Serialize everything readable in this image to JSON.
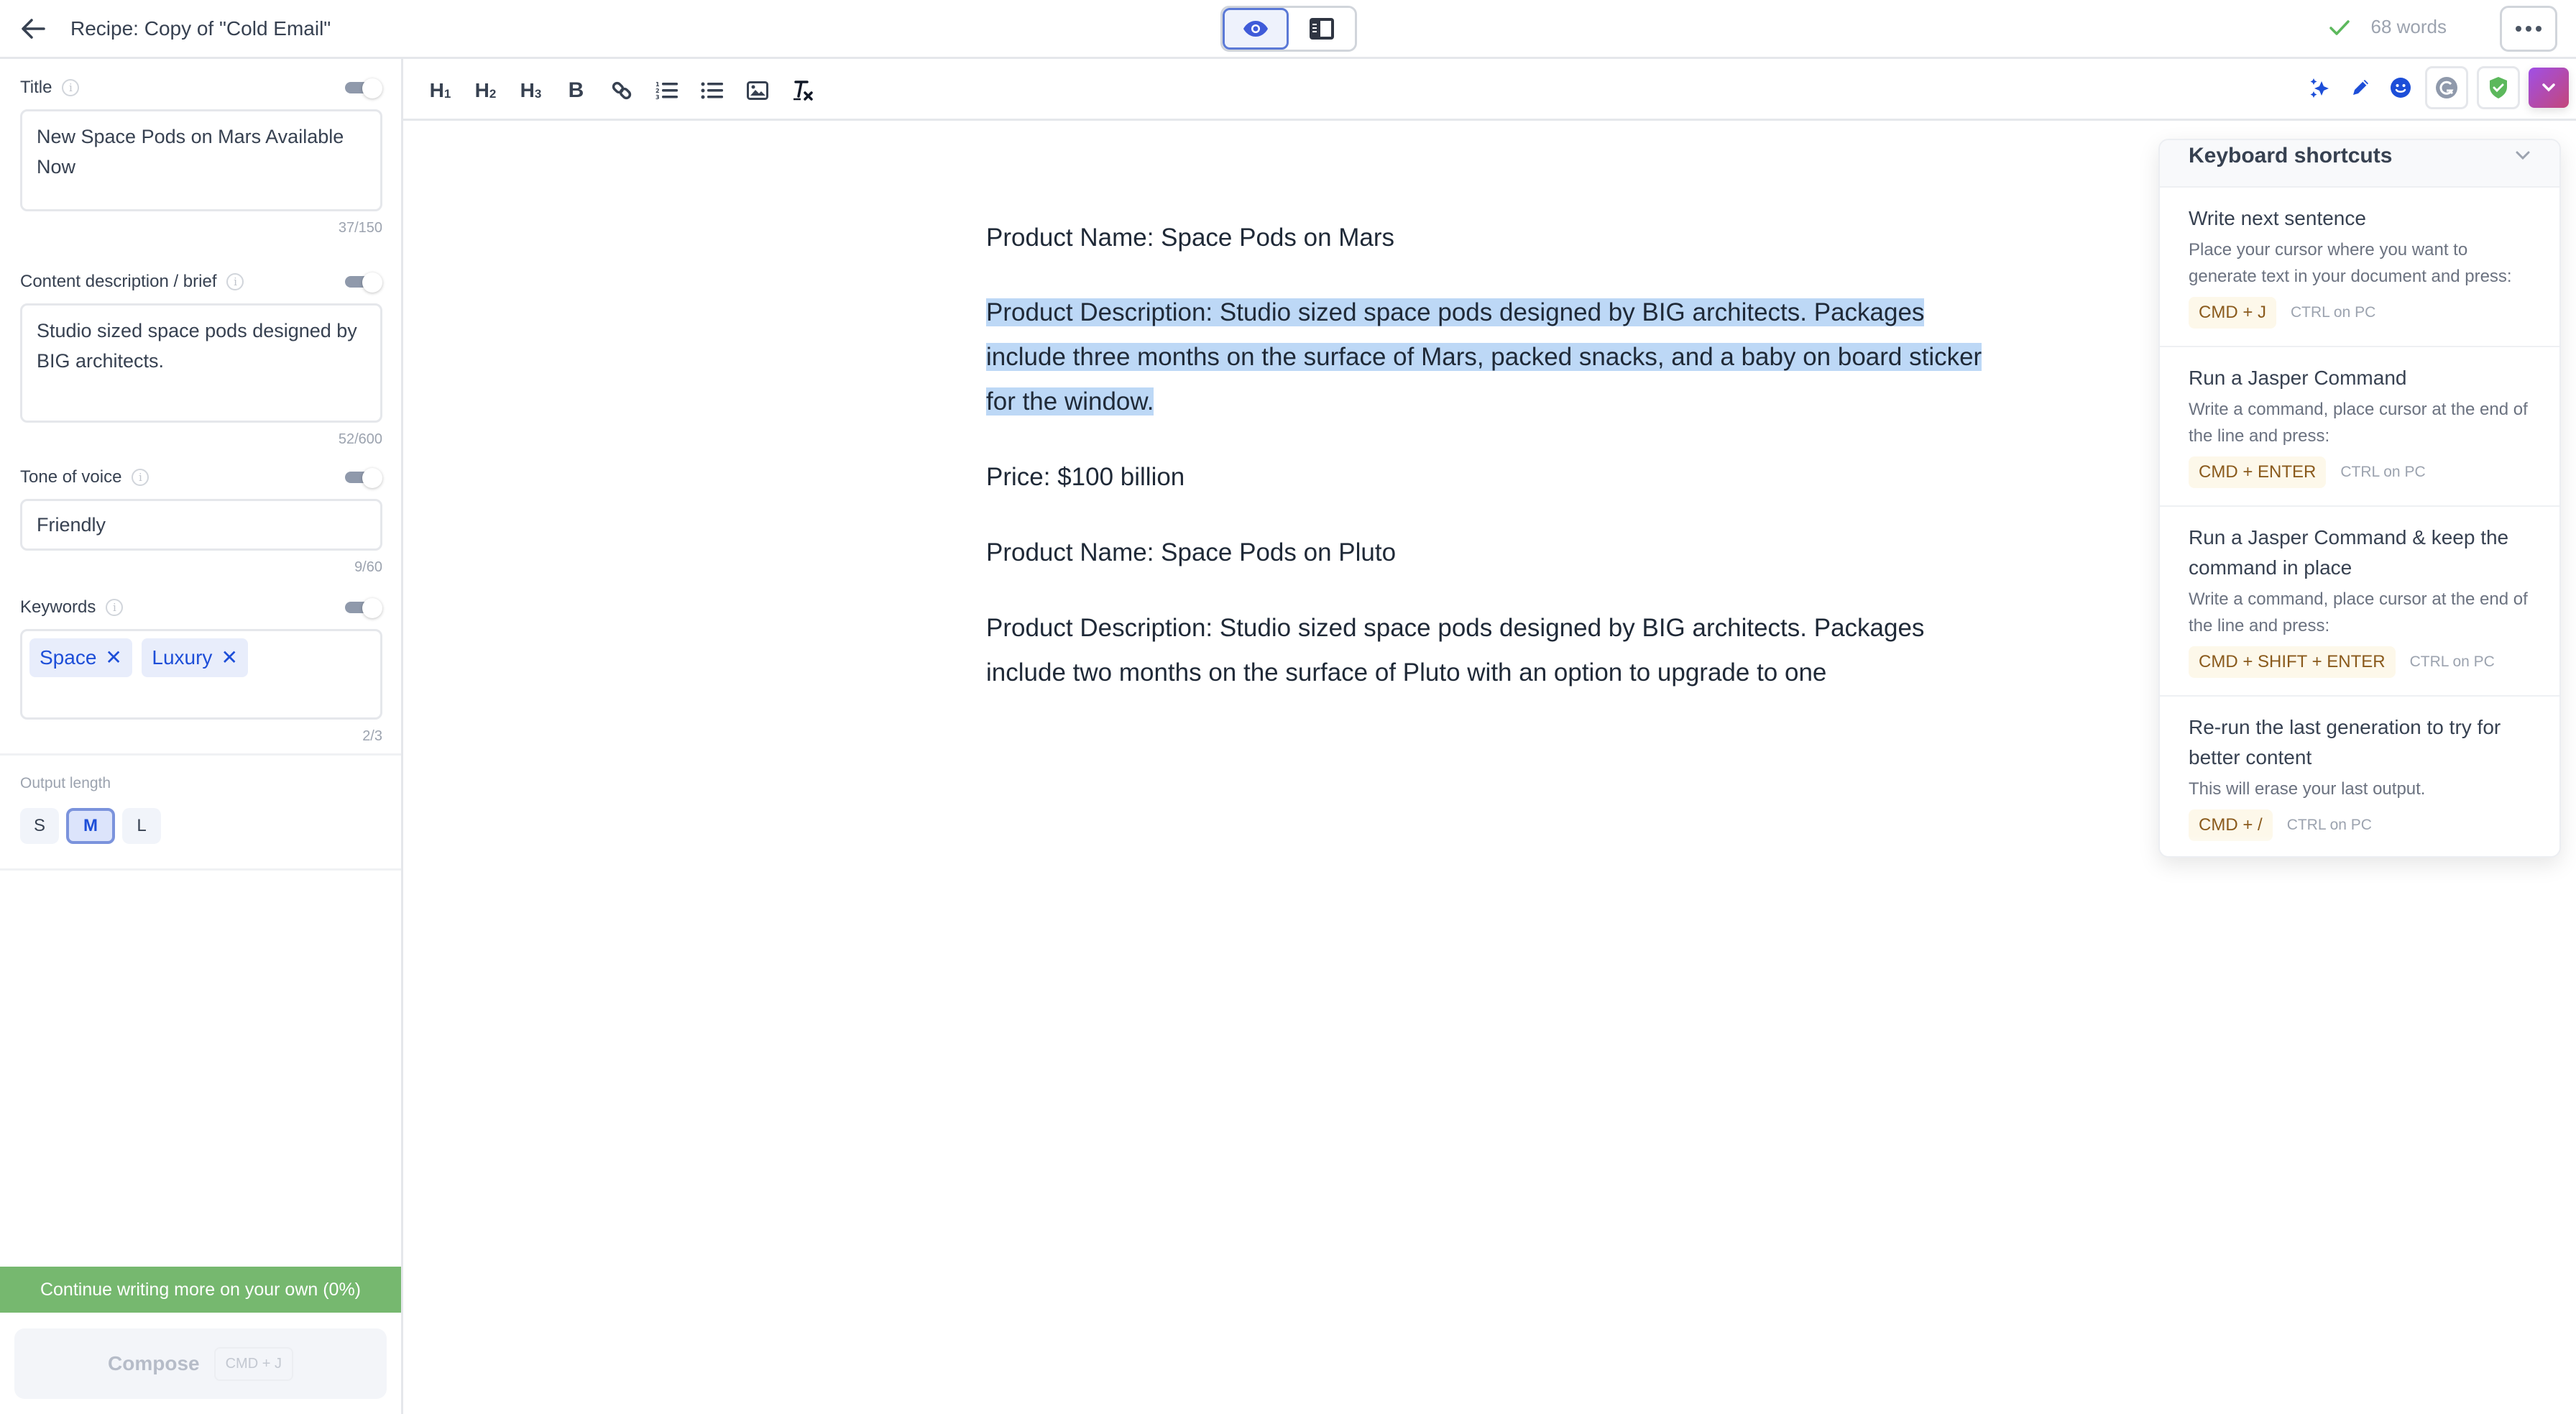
{
  "header": {
    "back_icon": "arrow-left-icon",
    "title": "Recipe: Copy of \"Cold Email\"",
    "view_modes": [
      {
        "name": "preview",
        "icon": "eye-icon",
        "active": true
      },
      {
        "name": "sidebar-layout",
        "icon": "sidebar-layout-icon",
        "active": false
      }
    ],
    "status_icon": "check-icon",
    "word_count": "68 words",
    "more_icon": "ellipsis-icon"
  },
  "sidebar": {
    "fields": [
      {
        "label": "Title",
        "value": "New Space Pods on Mars Available Now",
        "counter": "37/150",
        "toggle_on": true
      },
      {
        "label": "Content description / brief",
        "value": "Studio sized space pods designed by BIG architects.",
        "counter": "52/600",
        "toggle_on": true
      },
      {
        "label": "Tone of voice",
        "value": "Friendly",
        "counter": "9/60",
        "toggle_on": true
      },
      {
        "label": "Keywords",
        "chips": [
          "Space",
          "Luxury"
        ],
        "counter": "2/3",
        "toggle_on": true
      }
    ],
    "output_length": {
      "label": "Output length",
      "options": [
        "S",
        "M",
        "L"
      ],
      "selected": "M"
    },
    "progress": {
      "label": "Continue writing more on your own (0%)",
      "percent": 0,
      "color": "#76b86f"
    },
    "compose": {
      "label": "Compose",
      "shortcut": "CMD + J"
    }
  },
  "toolbar": {
    "format_buttons": [
      {
        "name": "heading-1",
        "label": "H",
        "sub": "1"
      },
      {
        "name": "heading-2",
        "label": "H",
        "sub": "2"
      },
      {
        "name": "heading-3",
        "label": "H",
        "sub": "3"
      },
      {
        "name": "bold",
        "label": "B"
      },
      {
        "name": "link",
        "icon": "link-icon"
      },
      {
        "name": "ordered-list",
        "icon": "ordered-list-icon"
      },
      {
        "name": "bullet-list",
        "icon": "bullet-list-icon"
      },
      {
        "name": "image",
        "icon": "image-icon"
      },
      {
        "name": "clear-format",
        "icon": "clear-format-icon"
      }
    ],
    "right_tools": [
      "sparkles-icon",
      "pencil-icon",
      "smiley-icon",
      "grammarly-icon",
      "shield-check-icon",
      "chevron-down-icon"
    ]
  },
  "document": {
    "paragraphs": [
      {
        "text": "Product Name: Space Pods on Mars",
        "selected": false
      },
      {
        "text": "Product Description: Studio sized space pods designed by BIG architects.  Packages include three months on the surface of Mars, packed snacks, and a baby on board sticker for the window.",
        "selected": true
      },
      {
        "text": "Price: $100 billion",
        "selected": false
      },
      {
        "text": "Product Name: Space Pods on Pluto",
        "selected": false
      },
      {
        "text": "Product Description: Studio sized space pods designed by BIG architects. Packages include two months on the surface of Pluto with an option to upgrade to one",
        "selected": false
      }
    ]
  },
  "shortcuts_panel": {
    "title": "Keyboard shortcuts",
    "items": [
      {
        "title": "Write next sentence",
        "description": "Place your cursor where you want to generate text in your document and press:",
        "keys": "CMD + J",
        "pc_note": "CTRL on PC"
      },
      {
        "title": "Run a Jasper Command",
        "description": "Write a command, place cursor at the end of the line and press:",
        "keys": "CMD + ENTER",
        "pc_note": "CTRL on PC"
      },
      {
        "title": "Run a Jasper Command & keep the command in place",
        "description": "Write a command, place cursor at the end of the line and press:",
        "keys": "CMD + SHIFT + ENTER",
        "pc_note": "CTRL on PC"
      },
      {
        "title": "Re-run the last generation to try for better content",
        "description": "This will erase your last output.",
        "keys": "CMD + /",
        "pc_note": "CTRL on PC"
      }
    ]
  },
  "colors": {
    "accent_blue": "#1d4ed8",
    "selection": "#bdd8f6",
    "progress_green": "#76b86f",
    "jasper_gradient_start": "#a04fe6",
    "jasper_gradient_end": "#c3477a",
    "shortcut_key_text": "#8a5a1c"
  }
}
